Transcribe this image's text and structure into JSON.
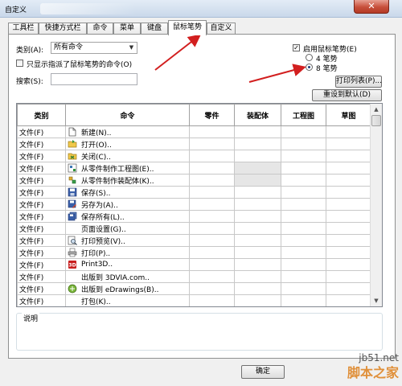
{
  "window": {
    "title": "自定义"
  },
  "tabs": [
    {
      "label": "工具栏"
    },
    {
      "label": "快捷方式栏"
    },
    {
      "label": "命令"
    },
    {
      "label": "菜单"
    },
    {
      "label": "键盘"
    },
    {
      "label": "鼠标笔势",
      "active": true
    },
    {
      "label": "自定义"
    }
  ],
  "filters": {
    "category_label": "类别(A):",
    "category_value": "所有命令",
    "only_assigned_label": "只显示指派了鼠标笔势的命令(O)",
    "search_label": "搜索(S):",
    "search_value": ""
  },
  "gestures": {
    "enable_label": "启用鼠标笔势(E)",
    "enable_checked": true,
    "option_4": "4 笔势",
    "option_8": "8 笔势",
    "selected": "8 笔势",
    "print_list_button": "打印列表(P)...",
    "reset_button": "重设到默认(D)"
  },
  "table": {
    "columns": [
      "类别",
      "命令",
      "零件",
      "装配体",
      "工程图",
      "草图"
    ],
    "rows": [
      {
        "category": "文件(F)",
        "icon": "new-document-icon",
        "command": "新建(N)..",
        "assembly_shaded": false
      },
      {
        "category": "文件(F)",
        "icon": "open-folder-icon",
        "command": "打开(O)..",
        "assembly_shaded": false
      },
      {
        "category": "文件(F)",
        "icon": "close-file-icon",
        "command": "关闭(C)..",
        "assembly_shaded": false
      },
      {
        "category": "文件(F)",
        "icon": "make-drawing-icon",
        "command": "从零件制作工程图(E)..",
        "assembly_shaded": true
      },
      {
        "category": "文件(F)",
        "icon": "make-assembly-icon",
        "command": "从零件制作装配体(K)..",
        "assembly_shaded": true
      },
      {
        "category": "文件(F)",
        "icon": "save-icon",
        "command": "保存(S)..",
        "assembly_shaded": false
      },
      {
        "category": "文件(F)",
        "icon": "save-as-icon",
        "command": "另存为(A)..",
        "assembly_shaded": false
      },
      {
        "category": "文件(F)",
        "icon": "save-all-icon",
        "command": "保存所有(L)..",
        "assembly_shaded": false
      },
      {
        "category": "文件(F)",
        "icon": "",
        "command": "页面设置(G)..",
        "assembly_shaded": false
      },
      {
        "category": "文件(F)",
        "icon": "print-preview-icon",
        "command": "打印预览(V)..",
        "assembly_shaded": false
      },
      {
        "category": "文件(F)",
        "icon": "print-icon",
        "command": "打印(P)..",
        "assembly_shaded": false
      },
      {
        "category": "文件(F)",
        "icon": "print3d-icon",
        "command": "Print3D..",
        "assembly_shaded": false
      },
      {
        "category": "文件(F)",
        "icon": "",
        "command": "出版到 3DVIA.com..",
        "assembly_shaded": false
      },
      {
        "category": "文件(F)",
        "icon": "edrawings-icon",
        "command": "出版到 eDrawings(B)..",
        "assembly_shaded": false
      },
      {
        "category": "文件(F)",
        "icon": "",
        "command": "打包(K)..",
        "assembly_shaded": false
      }
    ]
  },
  "description": {
    "label": "说明"
  },
  "footer": {
    "ok_button": "确定"
  },
  "watermark": {
    "site": "jb51.net",
    "brand": "脚本之家"
  },
  "colors": {
    "annotation_arrow": "#d21f1f",
    "titlebar": "#c9d8ea",
    "close_button": "#c74f3a"
  }
}
